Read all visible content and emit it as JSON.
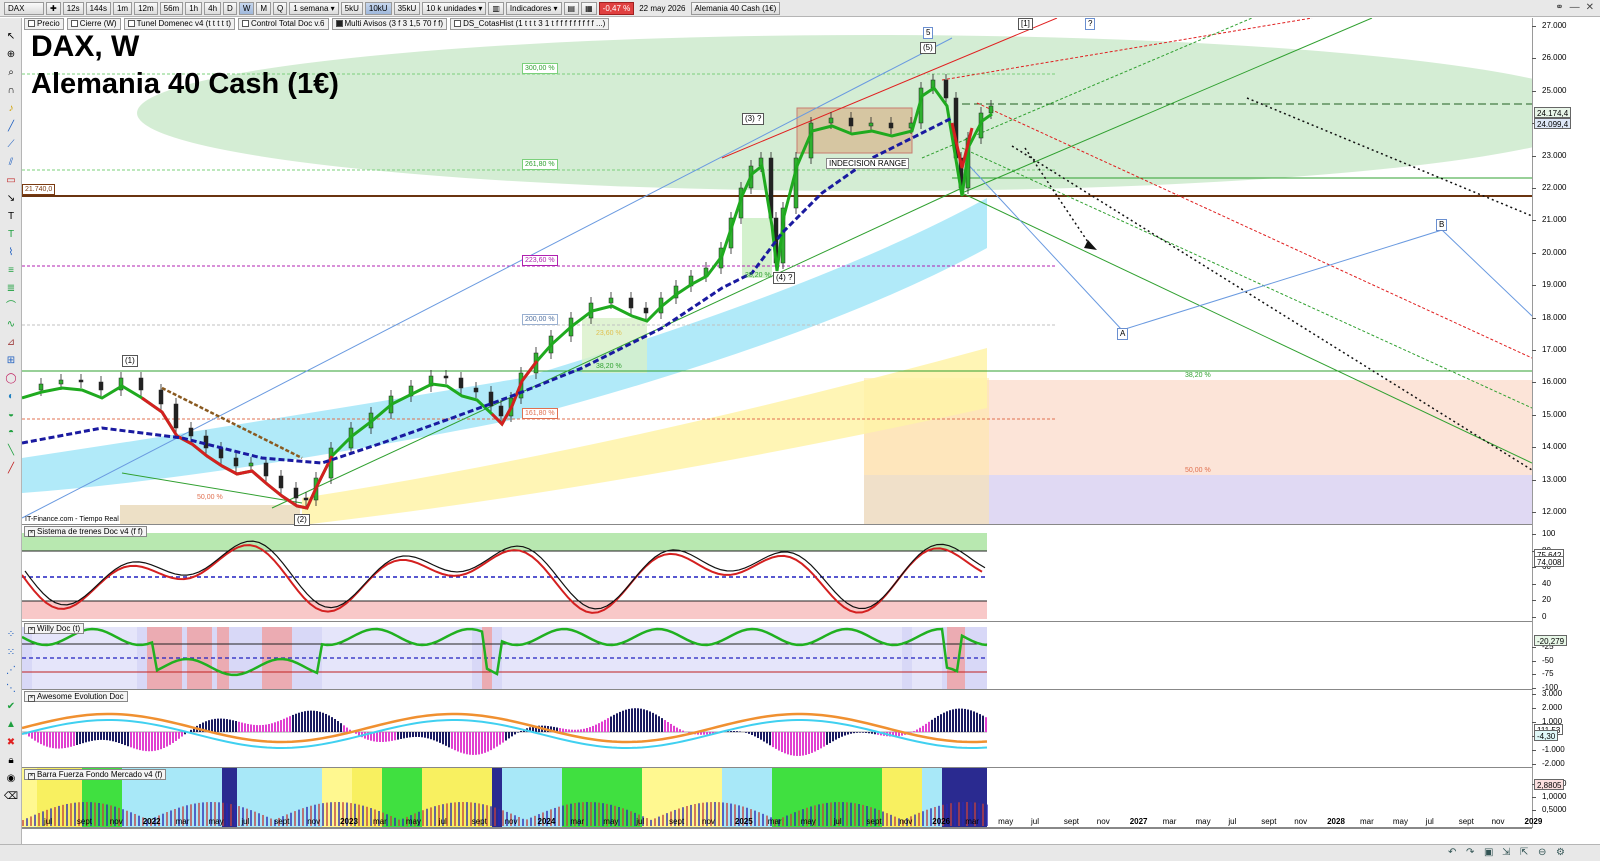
{
  "toolbar": {
    "symbol": "DAX",
    "timeframes": [
      "12s",
      "144s",
      "1m",
      "12m",
      "56m",
      "1h",
      "4h",
      "D",
      "W",
      "M",
      "Q"
    ],
    "period": "1 semana",
    "units_btns": [
      "5kU",
      "10kU",
      "35kU"
    ],
    "units": "10 k unidades",
    "indicators": "Indicadores",
    "change": "-0,47 %",
    "date": "22 may 2026",
    "instrument": "Alemania 40 Cash (1€)"
  },
  "tags": [
    "Precio",
    "Cierre (W)",
    "Tunel Domenec v4 (t t t t t)",
    "Control Total Doc v.6",
    "Multi Avisos (3 f 3 1,5 70 f f)",
    "DS_CotasHist (1 t t t 3 1 t f f f f f f f f f ...)"
  ],
  "chart": {
    "title_symbol": "DAX, W",
    "title_name": "Alemania 40 Cash (1€)",
    "source": "IT-Finance.com - Tiempo Real",
    "level_label": "21.740,0",
    "indecision": "INDECISION RANGE",
    "fib_labels": [
      "300,00 %",
      "261,80 %",
      "223,60 %",
      "200,00 %",
      "161,80 %",
      "38,20 %",
      "50,00 %",
      "23,60 %",
      "38,20 %",
      "38,20 %",
      "50,00 %"
    ],
    "wave_labels": [
      "5",
      "(5)",
      "(3) ?",
      "(1)",
      "(2)",
      "(4) ?",
      "[1]",
      "?",
      "A",
      "B"
    ],
    "price_axis": [
      "27.000",
      "26.000",
      "25.000",
      "24.000",
      "23.000",
      "22.000",
      "21.000",
      "20.000",
      "19.000",
      "18.000",
      "17.000",
      "16.000",
      "15.000",
      "14.000",
      "13.000",
      "12.000"
    ],
    "price_tags": [
      "24.174,4",
      "24.099,4"
    ]
  },
  "panes": {
    "trenes": {
      "name": "Sistema de trenes Doc v4 (f f)",
      "axis": [
        "100",
        "80",
        "60",
        "40",
        "20",
        "0"
      ],
      "tags": [
        "75,642",
        "74,008"
      ]
    },
    "willy": {
      "name": "Willy Doc (t)",
      "axis": [
        "-25",
        "-50",
        "-75",
        "-100"
      ],
      "tags": [
        "-20,279"
      ]
    },
    "awesome": {
      "name": "Awesome Evolution Doc",
      "axis": [
        "3.000",
        "2.000",
        "1.000",
        "0",
        "-1.000",
        "-2.000"
      ],
      "tags": [
        "111,53",
        "-4,30"
      ]
    },
    "barra": {
      "name": "Barra Fuerza Fondo Mercado v4 (f)",
      "axis": [
        "1,5000",
        "1,0000",
        "0,5000"
      ],
      "tags": [
        "2,8805"
      ]
    }
  },
  "time_axis": [
    {
      "t": "jul",
      "year": false
    },
    {
      "t": "sept",
      "year": false
    },
    {
      "t": "nov",
      "year": false
    },
    {
      "t": "2022",
      "year": true
    },
    {
      "t": "mar",
      "year": false
    },
    {
      "t": "may",
      "year": false
    },
    {
      "t": "jul",
      "year": false
    },
    {
      "t": "sept",
      "year": false
    },
    {
      "t": "nov",
      "year": false
    },
    {
      "t": "2023",
      "year": true
    },
    {
      "t": "mar",
      "year": false
    },
    {
      "t": "may",
      "year": false
    },
    {
      "t": "jul",
      "year": false
    },
    {
      "t": "sept",
      "year": false
    },
    {
      "t": "nov",
      "year": false
    },
    {
      "t": "2024",
      "year": true
    },
    {
      "t": "mar",
      "year": false
    },
    {
      "t": "may",
      "year": false
    },
    {
      "t": "jul",
      "year": false
    },
    {
      "t": "sept",
      "year": false
    },
    {
      "t": "nov",
      "year": false
    },
    {
      "t": "2025",
      "year": true
    },
    {
      "t": "mar",
      "year": false
    },
    {
      "t": "may",
      "year": false
    },
    {
      "t": "jul",
      "year": false
    },
    {
      "t": "sept",
      "year": false
    },
    {
      "t": "nov",
      "year": false
    },
    {
      "t": "2026",
      "year": true
    },
    {
      "t": "mar",
      "year": false
    },
    {
      "t": "may",
      "year": false
    },
    {
      "t": "jul",
      "year": false
    },
    {
      "t": "sept",
      "year": false
    },
    {
      "t": "nov",
      "year": false
    },
    {
      "t": "2027",
      "year": true
    },
    {
      "t": "mar",
      "year": false
    },
    {
      "t": "may",
      "year": false
    },
    {
      "t": "jul",
      "year": false
    },
    {
      "t": "sept",
      "year": false
    },
    {
      "t": "nov",
      "year": false
    },
    {
      "t": "2028",
      "year": true
    },
    {
      "t": "mar",
      "year": false
    },
    {
      "t": "may",
      "year": false
    },
    {
      "t": "jul",
      "year": false
    },
    {
      "t": "sept",
      "year": false
    },
    {
      "t": "nov",
      "year": false
    },
    {
      "t": "2029",
      "year": true
    }
  ],
  "colors": {
    "up": "#1faa1f",
    "down": "#d42020",
    "trend": "#1a1aa0",
    "cyan": "#a8e8f8",
    "yellow": "#fff3a8"
  }
}
